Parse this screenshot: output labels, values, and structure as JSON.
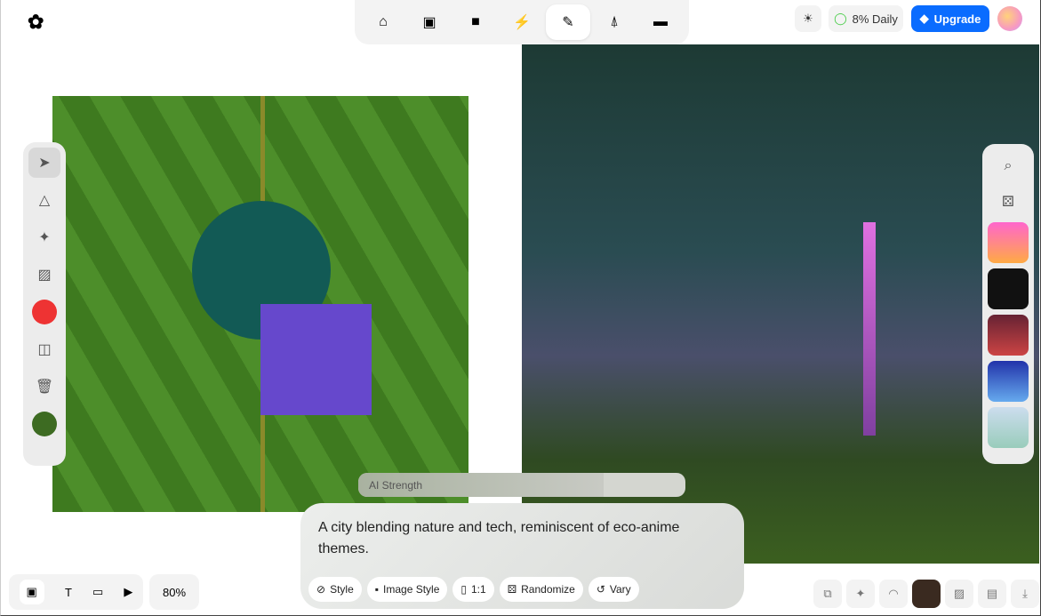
{
  "header": {
    "daily": "8% Daily",
    "upgrade": "Upgrade"
  },
  "canvas": {
    "ai_strength_label": "AI Strength",
    "ai_strength_value": 0.75
  },
  "prompt": {
    "text": "A city blending nature and tech, reminiscent of eco-anime themes.",
    "chips": [
      "Style",
      "Image Style",
      "1:1",
      "Randomize",
      "Vary"
    ]
  },
  "bottom": {
    "zoom": "80%"
  }
}
